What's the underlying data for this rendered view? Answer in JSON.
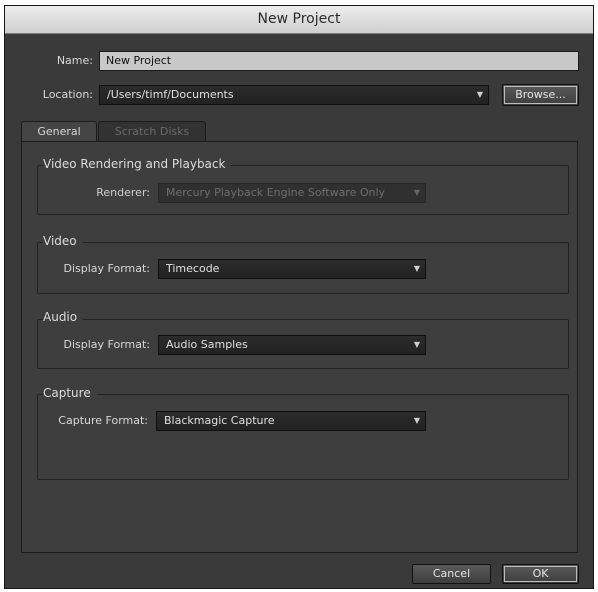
{
  "window": {
    "title": "New Project"
  },
  "name_row": {
    "label": "Name:",
    "value": "New Project"
  },
  "location_row": {
    "label": "Location:",
    "value": "/Users/timf/Documents",
    "browse_label": "Browse..."
  },
  "tabs": [
    {
      "label": "General",
      "active": true
    },
    {
      "label": "Scratch Disks",
      "active": false
    }
  ],
  "sections": {
    "video_rendering": {
      "title": "Video Rendering and Playback",
      "field_label": "Renderer:",
      "value": "Mercury Playback Engine Software Only"
    },
    "video": {
      "title": "Video",
      "field_label": "Display Format:",
      "value": "Timecode"
    },
    "audio": {
      "title": "Audio",
      "field_label": "Display Format:",
      "value": "Audio Samples"
    },
    "capture": {
      "title": "Capture",
      "field_label": "Capture Format:",
      "value": "Blackmagic Capture"
    }
  },
  "footer": {
    "cancel_label": "Cancel",
    "ok_label": "OK"
  },
  "colors": {
    "background": "#3a3a3a",
    "panel": "#3e3e3e",
    "field": "#c8c8c8",
    "titlebar": "#dcdcdc"
  }
}
